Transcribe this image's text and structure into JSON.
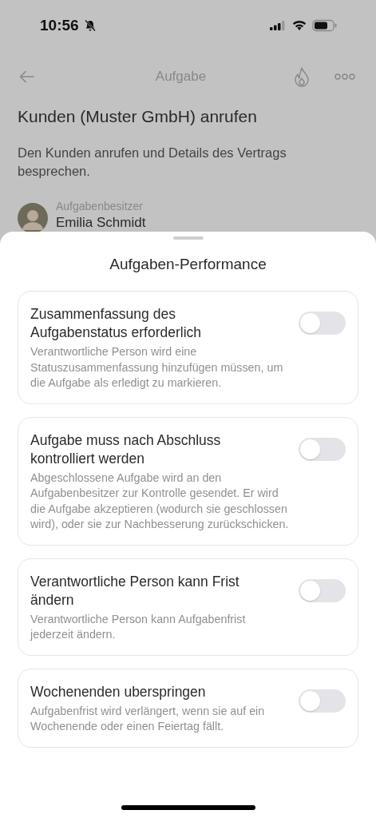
{
  "status_bar": {
    "time": "10:56"
  },
  "nav": {
    "title": "Aufgabe"
  },
  "task": {
    "title": "Kunden (Muster GmbH) anrufen",
    "description": "Den Kunden anrufen und Details des Vertrags besprechen.",
    "owner_label": "Aufgabenbesitzer",
    "owner_name": "Emilia Schmidt"
  },
  "sheet": {
    "title": "Aufgaben-Performance",
    "options": [
      {
        "title": "Zusammenfassung des Aufgabenstatus erforderlich",
        "description": "Verantwortliche Person wird eine Statuszusammenfassung hinzufügen müssen, um die Aufgabe als erledigt zu markieren.",
        "on": false
      },
      {
        "title": "Aufgabe muss nach Abschluss kontrolliert werden",
        "description": "Abgeschlossene Aufgabe wird an den Aufgabenbesitzer zur Kontrolle gesendet. Er wird die Aufgabe akzeptieren (wodurch sie geschlossen wird), oder  sie zur Nachbesserung zurückschicken.",
        "on": false
      },
      {
        "title": "Verantwortliche Person kann Frist ändern",
        "description": "Verantwortliche Person kann Aufgabenfrist jederzeit ändern.",
        "on": false
      },
      {
        "title": "Wochenenden uberspringen",
        "description": "Aufgabenfrist wird verlängert, wenn sie auf ein Wochenende oder einen Feiertag fällt.",
        "on": false
      }
    ]
  }
}
